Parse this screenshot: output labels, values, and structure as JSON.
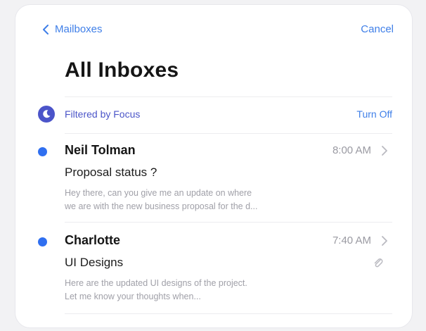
{
  "nav": {
    "back_label": "Mailboxes",
    "cancel_label": "Cancel"
  },
  "title": "All Inboxes",
  "filter": {
    "label": "Filtered by Focus",
    "action_label": "Turn Off",
    "icon": "moon-icon"
  },
  "messages": [
    {
      "sender": "Neil Tolman",
      "time": "8:00 AM",
      "subject": "Proposal status ?",
      "preview_line1": "Hey there, can you give me an update on where",
      "preview_line2": "we are with the new business proposal for the d...",
      "unread": true,
      "has_attachment": false
    },
    {
      "sender": "Charlotte",
      "time": "7:40 AM",
      "subject": "UI Designs",
      "preview_line1": "Here are the updated UI designs of the project.",
      "preview_line2": "Let me know your thoughts when...",
      "unread": true,
      "has_attachment": true
    }
  ],
  "colors": {
    "accent": "#3f7fe8",
    "unread_dot": "#2f6ff0",
    "focus": "#4b54c9"
  }
}
